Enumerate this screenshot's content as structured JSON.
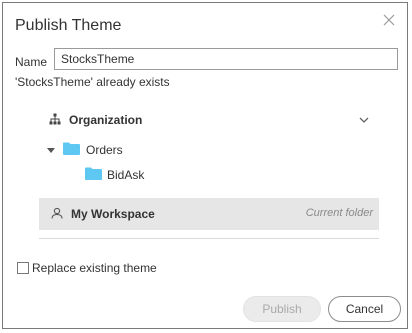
{
  "dialog": {
    "title": "Publish Theme",
    "name_label": "Name",
    "name_value": "StocksTheme",
    "exists_message": "'StocksTheme' already exists"
  },
  "tree": {
    "organization_label": "Organization",
    "orders_label": "Orders",
    "bidask_label": "BidAsk",
    "workspace_label": "My Workspace",
    "current_folder_label": "Current folder"
  },
  "options": {
    "replace_label": "Replace existing theme",
    "replace_checked": false
  },
  "buttons": {
    "publish_label": "Publish",
    "cancel_label": "Cancel"
  },
  "colors": {
    "folder": "#5ec8f2",
    "selected_row": "#e6e6e6",
    "disabled_button": "#ebebeb"
  },
  "icons": [
    "close-icon",
    "organization-icon",
    "chevron-down-icon",
    "caret-down-icon",
    "folder-icon",
    "user-icon"
  ]
}
